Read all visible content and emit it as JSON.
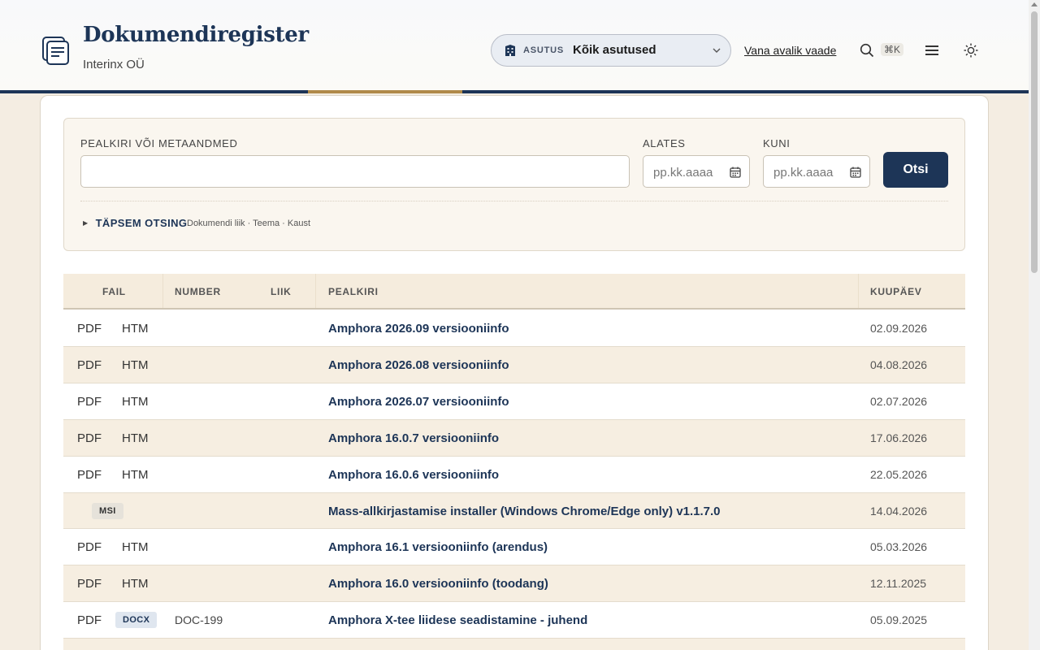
{
  "header": {
    "title": "Dokumendiregister",
    "subtitle": "Interinx OÜ",
    "org_label": "ASUTUS",
    "org_value": "Kõik asutused",
    "old_view_link": "Vana avalik vaade",
    "shortcut_hint": "⌘K"
  },
  "filters": {
    "title_label": "PEALKIRI VÕI METAANDMED",
    "title_value": "",
    "from_label": "ALATES",
    "from_placeholder": "pp.kk.aaaa",
    "to_label": "KUNI",
    "to_placeholder": "pp.kk.aaaa",
    "search_button": "Otsi",
    "advanced_label": "TÄPSEM OTSING",
    "advanced_hint": "Dokumendi liik · Teema · Kaust"
  },
  "table": {
    "columns": [
      "FAIL",
      "NUMBER",
      "LIIK",
      "PEALKIRI",
      "KUUPÄEV"
    ],
    "rows": [
      {
        "files": [
          "PDF",
          "HTM"
        ],
        "number": "",
        "type": "",
        "title": "Amphora 2026.09 versiooniinfo",
        "date": "02.09.2026"
      },
      {
        "files": [
          "PDF",
          "HTM"
        ],
        "number": "",
        "type": "",
        "title": "Amphora 2026.08 versiooniinfo",
        "date": "04.08.2026"
      },
      {
        "files": [
          "PDF",
          "HTM"
        ],
        "number": "",
        "type": "",
        "title": "Amphora 2026.07 versiooniinfo",
        "date": "02.07.2026"
      },
      {
        "files": [
          "PDF",
          "HTM"
        ],
        "number": "",
        "type": "",
        "title": "Amphora 16.0.7 versiooniinfo",
        "date": "17.06.2026"
      },
      {
        "files": [
          "PDF",
          "HTM"
        ],
        "number": "",
        "type": "",
        "title": "Amphora 16.0.6 versiooniinfo",
        "date": "22.05.2026"
      },
      {
        "files": [
          "MSI"
        ],
        "number": "",
        "type": "",
        "title": "Mass-allkirjastamise installer (Windows Chrome/Edge only) v1.1.7.0",
        "date": "14.04.2026"
      },
      {
        "files": [
          "PDF",
          "HTM"
        ],
        "number": "",
        "type": "",
        "title": "Amphora 16.1 versiooniinfo (arendus)",
        "date": "05.03.2026"
      },
      {
        "files": [
          "PDF",
          "HTM"
        ],
        "number": "",
        "type": "",
        "title": "Amphora 16.0 versiooniinfo (toodang)",
        "date": "12.11.2025"
      },
      {
        "files": [
          "PDF",
          "DOCX"
        ],
        "number": "DOC-199",
        "type": "",
        "title": "Amphora X-tee liidese seadistamine - juhend",
        "date": "05.09.2025"
      }
    ]
  },
  "colors": {
    "brand": "#1d3557",
    "accent": "#b08a4a",
    "row_alt": "#f6eee1",
    "page_bg": "#f4ede2"
  },
  "icons": [
    "document-stack-icon",
    "building-icon",
    "chevron-down-icon",
    "search-icon",
    "menu-icon",
    "sun-icon",
    "calendar-icon"
  ]
}
